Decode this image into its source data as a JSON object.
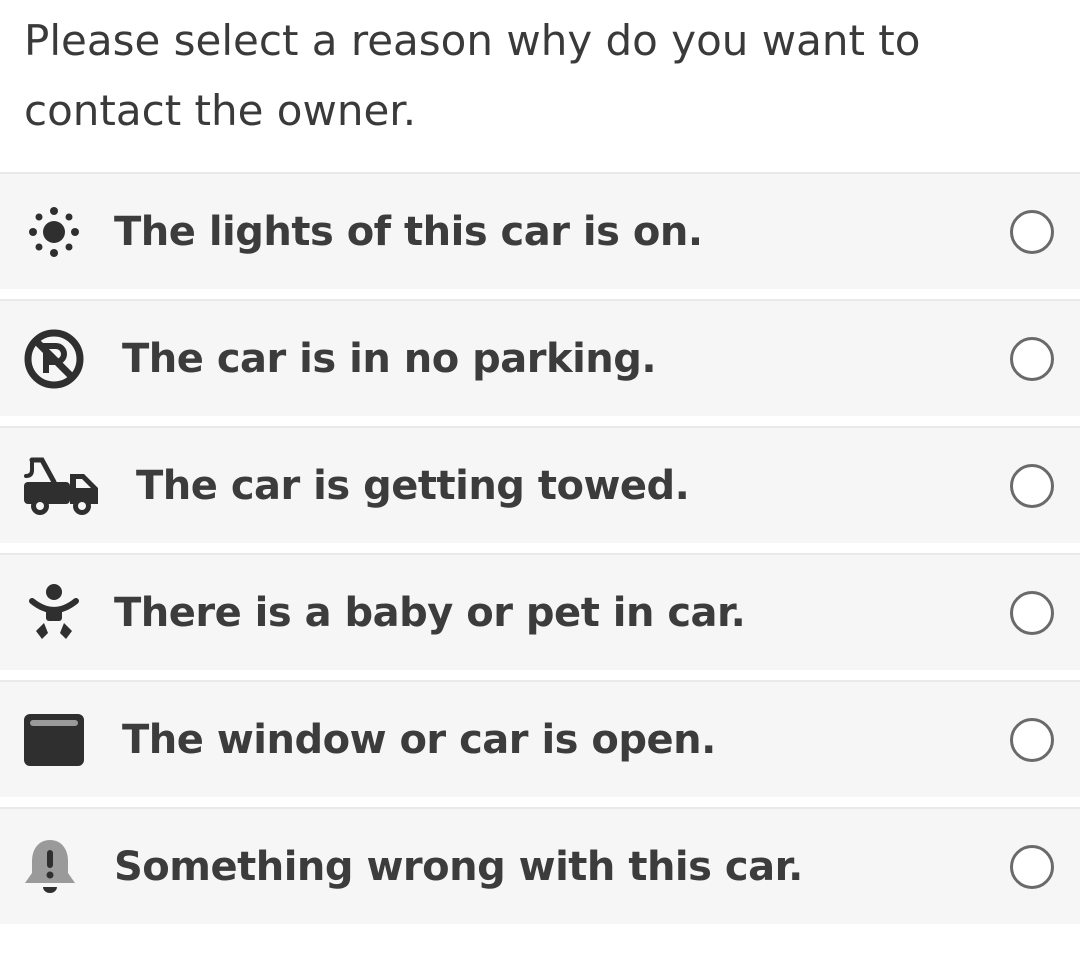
{
  "prompt": "Please select a reason why do you want to contact the owner.",
  "options": [
    {
      "label": "The lights of this car is on.",
      "icon": "light-icon",
      "selected": false
    },
    {
      "label": "The car is in no parking.",
      "icon": "no-parking-icon",
      "selected": false
    },
    {
      "label": "The car is getting towed.",
      "icon": "tow-truck-icon",
      "selected": false
    },
    {
      "label": "There is a baby or pet in car.",
      "icon": "baby-icon",
      "selected": false
    },
    {
      "label": "The window or car is open.",
      "icon": "window-icon",
      "selected": false
    },
    {
      "label": "Something wrong with this car.",
      "icon": "alert-bell-icon",
      "selected": false
    }
  ],
  "colors": {
    "text": "#3a3a3a",
    "row_background": "#f6f6f6",
    "radio_border": "#6a6a6a"
  }
}
